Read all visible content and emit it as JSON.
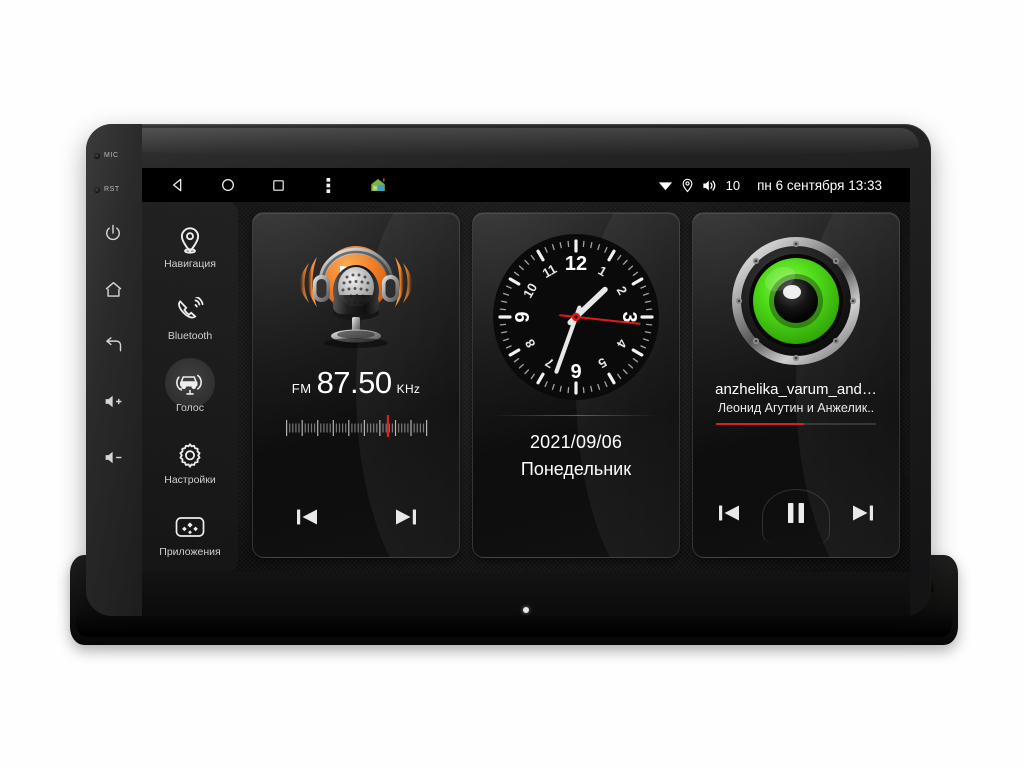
{
  "device": {
    "left_panel": {
      "mic_label": "MIC",
      "rst_label": "RST",
      "buttons": [
        {
          "name": "power",
          "icon": "power-icon"
        },
        {
          "name": "home",
          "icon": "home-icon"
        },
        {
          "name": "back",
          "icon": "back-arrow-icon"
        },
        {
          "name": "volume-up",
          "icon": "volume-up-icon"
        },
        {
          "name": "volume-down",
          "icon": "volume-down-icon"
        }
      ]
    }
  },
  "statusbar": {
    "nav": [
      {
        "name": "back",
        "icon": "triangle-back-icon"
      },
      {
        "name": "home",
        "icon": "circle-home-icon"
      },
      {
        "name": "recents",
        "icon": "square-recents-icon"
      },
      {
        "name": "overflow",
        "icon": "three-dots-icon"
      },
      {
        "name": "launcher",
        "icon": "house-launcher-icon"
      }
    ],
    "wifi_icon": "wifi-icon",
    "location_icon": "location-pin-icon",
    "volume_icon": "speaker-icon",
    "volume_value": "10",
    "datetime": "пн 6 сентября 13:33"
  },
  "sidebar": {
    "items": [
      {
        "label": "Навигация",
        "icon": "location-pin-icon",
        "active": false
      },
      {
        "label": "Bluetooth",
        "icon": "bluetooth-phone-icon",
        "active": false
      },
      {
        "label": "Голос",
        "icon": "voice-car-icon",
        "active": true
      },
      {
        "label": "Настройки",
        "icon": "gear-icon",
        "active": false
      },
      {
        "label": "Приложения",
        "icon": "apps-grid-icon",
        "active": false
      }
    ]
  },
  "widgets": {
    "radio": {
      "band": "FM",
      "frequency": "87.50",
      "unit": "KHz",
      "tuner_position_pct": 72,
      "prev_label": "prev-station",
      "next_label": "next-station"
    },
    "clock": {
      "hours": 1,
      "minutes": 33,
      "seconds": 16,
      "numerals": [
        "12",
        "1",
        "2",
        "3",
        "4",
        "5",
        "6",
        "7",
        "8",
        "9",
        "10",
        "11"
      ],
      "date": "2021/09/06",
      "weekday": "Понедельник"
    },
    "player": {
      "track_title": "anzhelika_varum_and…",
      "artist": "Леонид Агутин и Анжелик..",
      "progress_pct": 55,
      "prev_label": "previous-track",
      "playpause_label": "pause",
      "next_label": "next-track",
      "is_playing": true
    }
  },
  "colors": {
    "accent_orange": "#f07820",
    "accent_green": "#4cd916",
    "progress_red": "#d32222",
    "second_hand_red": "#e01a1a",
    "text_primary": "#ffffff",
    "bezel": "#1b1b1c"
  }
}
